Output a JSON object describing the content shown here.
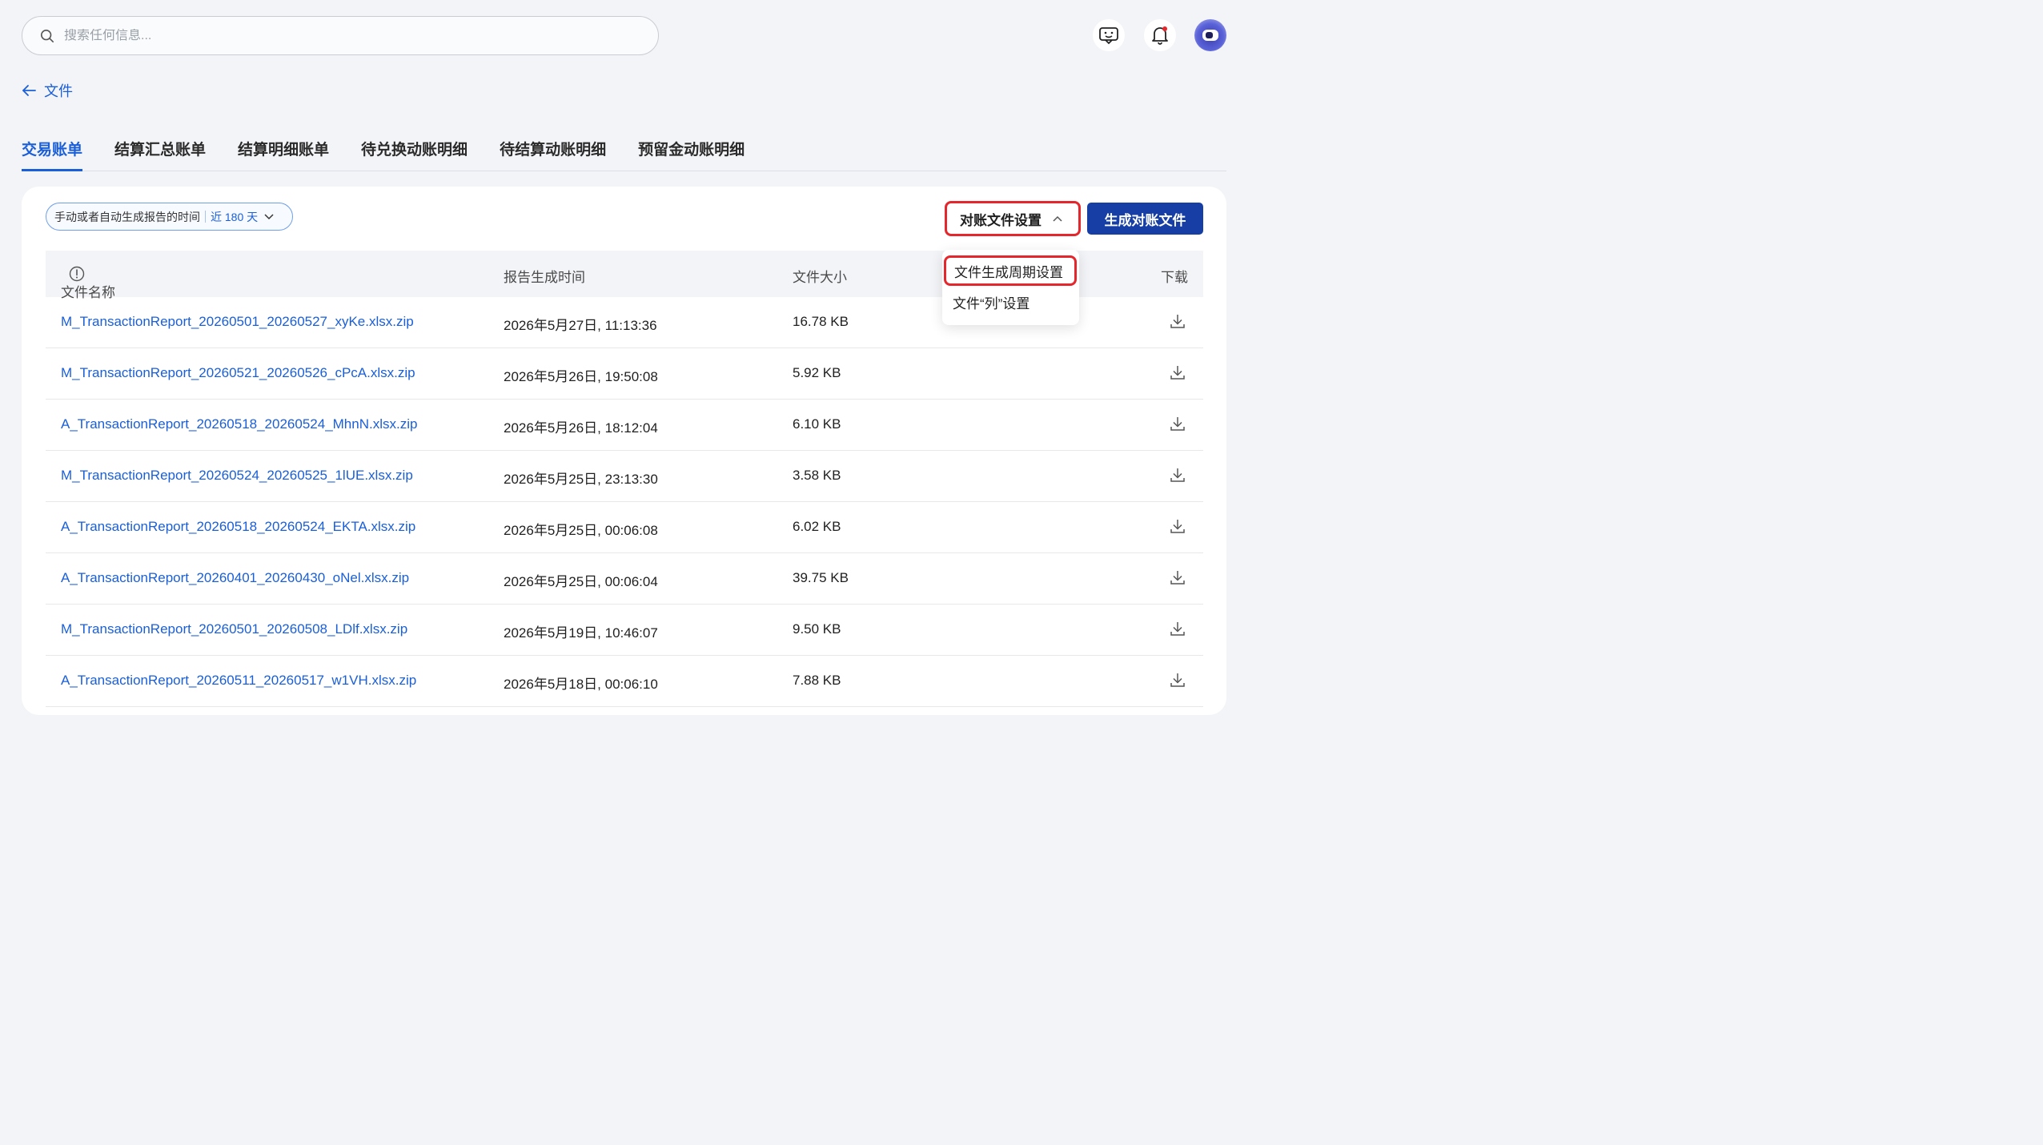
{
  "search": {
    "placeholder": "搜索任何信息..."
  },
  "header": {
    "back_label": "文件"
  },
  "tabs": [
    {
      "label": "交易账单",
      "active": true
    },
    {
      "label": "结算汇总账单",
      "active": false
    },
    {
      "label": "结算明细账单",
      "active": false
    },
    {
      "label": "待兑换动账明细",
      "active": false
    },
    {
      "label": "待结算动账明细",
      "active": false
    },
    {
      "label": "预留金动账明细",
      "active": false
    }
  ],
  "filter": {
    "label": "手动或者自动生成报告的时间",
    "value": "近 180 天"
  },
  "toolbar": {
    "settings_label": "对账文件设置",
    "generate_label": "生成对账文件"
  },
  "menu": {
    "items": [
      {
        "label": "文件生成周期设置"
      },
      {
        "label": "文件“列”设置"
      }
    ]
  },
  "table": {
    "columns": {
      "name": "文件名称",
      "time": "报告生成时间",
      "size": "文件大小",
      "download": "下载"
    },
    "rows": [
      {
        "name": "M_TransactionReport_20260501_20260527_xyKe.xlsx.zip",
        "time": "2026年5月27日, 11:13:36",
        "size": "16.78 KB"
      },
      {
        "name": "M_TransactionReport_20260521_20260526_cPcA.xlsx.zip",
        "time": "2026年5月26日, 19:50:08",
        "size": "5.92 KB"
      },
      {
        "name": "A_TransactionReport_20260518_20260524_MhnN.xlsx.zip",
        "time": "2026年5月26日, 18:12:04",
        "size": "6.10 KB"
      },
      {
        "name": "M_TransactionReport_20260524_20260525_1lUE.xlsx.zip",
        "time": "2026年5月25日, 23:13:30",
        "size": "3.58 KB"
      },
      {
        "name": "A_TransactionReport_20260518_20260524_EKTA.xlsx.zip",
        "time": "2026年5月25日, 00:06:08",
        "size": "6.02 KB"
      },
      {
        "name": "A_TransactionReport_20260401_20260430_oNel.xlsx.zip",
        "time": "2026年5月25日, 00:06:04",
        "size": "39.75 KB"
      },
      {
        "name": "M_TransactionReport_20260501_20260508_LDlf.xlsx.zip",
        "time": "2026年5月19日, 10:46:07",
        "size": "9.50 KB"
      },
      {
        "name": "A_TransactionReport_20260511_20260517_w1VH.xlsx.zip",
        "time": "2026年5月18日, 00:06:10",
        "size": "7.88 KB"
      }
    ]
  },
  "colors": {
    "accent": "#1a5fd8",
    "primary_button": "#163ea5",
    "highlight_border": "#e4262d"
  }
}
